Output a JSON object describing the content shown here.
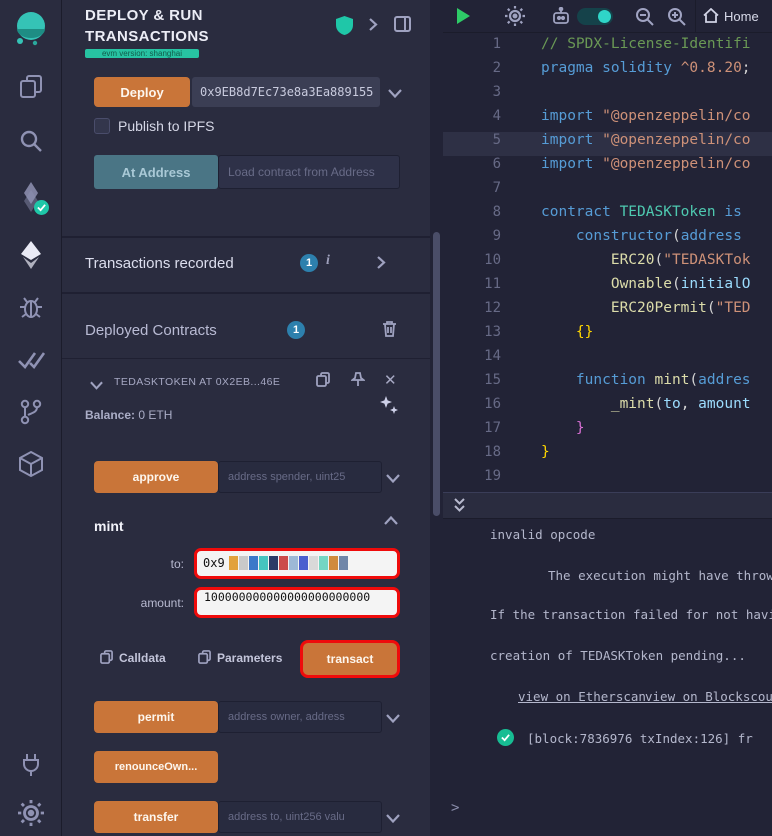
{
  "colors": {
    "accent_orange": "#c97539",
    "accent_teal": "#27c3a2",
    "badge_blue": "#2d80ad",
    "annotation_red": "#ef0b0b",
    "panel_bg": "#2a2c3f",
    "editor_bg": "#222336"
  },
  "header": {
    "title": "DEPLOY & RUN TRANSACTIONS",
    "evm_badge": "evm version: shanghai"
  },
  "deploy": {
    "deploy_button": "Deploy",
    "address_value": "0x9EB8d7Ec73e8a3Ea889155",
    "publish_label": "Publish to IPFS",
    "at_address_button": "At Address",
    "at_address_placeholder": "Load contract from Address"
  },
  "sections": {
    "transactions_recorded": "Transactions recorded",
    "transactions_count": "1",
    "info_glyph": "i",
    "deployed_contracts": "Deployed Contracts",
    "deployed_count": "1"
  },
  "contract": {
    "title": "TEDASKTOKEN AT 0X2EB...46E",
    "balance_label": "Balance:",
    "balance_value": "0 ETH",
    "approve": {
      "label": "approve",
      "placeholder": "address spender, uint25"
    },
    "mint": {
      "label": "mint",
      "to_label": "to:",
      "to_value": "0x9",
      "to_censor_colors": [
        "#e2a13c",
        "#c9c9c9",
        "#3c78c9",
        "#45c4bf",
        "#2b3a67",
        "#cc4b4b",
        "#9db9d6",
        "#4a5fcf",
        "#d9d9d9",
        "#74d6c3",
        "#d08a3c",
        "#7086a8"
      ],
      "amount_label": "amount:",
      "amount_value": "100000000000000000000000",
      "calldata": "Calldata",
      "parameters": "Parameters",
      "transact": "transact"
    },
    "permit": {
      "label": "permit",
      "placeholder": "address owner, address"
    },
    "renounce": {
      "label": "renounceOwn..."
    },
    "transfer": {
      "label": "transfer",
      "placeholder": "address to, uint256 valu"
    }
  },
  "editor": {
    "tab_home": "Home",
    "lines": [
      {
        "n": 1,
        "segs": [
          [
            "cmt",
            "// SPDX-License-Identifi"
          ]
        ]
      },
      {
        "n": 2,
        "segs": [
          [
            "kw",
            "pragma solidity "
          ],
          [
            "str",
            "^0.8.20"
          ],
          [
            "txt",
            ";"
          ]
        ]
      },
      {
        "n": 3,
        "segs": []
      },
      {
        "n": 4,
        "segs": [
          [
            "kw",
            "import "
          ],
          [
            "str",
            "\"@openzeppelin/co"
          ]
        ]
      },
      {
        "n": 5,
        "hl": true,
        "segs": [
          [
            "kw",
            "import "
          ],
          [
            "str",
            "\"@openzeppelin/co"
          ]
        ]
      },
      {
        "n": 6,
        "segs": [
          [
            "kw",
            "import "
          ],
          [
            "str",
            "\"@openzeppelin/co"
          ]
        ]
      },
      {
        "n": 7,
        "segs": []
      },
      {
        "n": 8,
        "segs": [
          [
            "kw",
            "contract "
          ],
          [
            "typ",
            "TEDASKToken "
          ],
          [
            "kw",
            "is"
          ]
        ]
      },
      {
        "n": 9,
        "segs": [
          [
            "txt",
            "    "
          ],
          [
            "kw",
            "constructor"
          ],
          [
            "txt",
            "("
          ],
          [
            "kw",
            "address"
          ]
        ]
      },
      {
        "n": 10,
        "segs": [
          [
            "txt",
            "        "
          ],
          [
            "fn",
            "ERC20"
          ],
          [
            "txt",
            "("
          ],
          [
            "str",
            "\"TEDASKTok"
          ]
        ]
      },
      {
        "n": 11,
        "segs": [
          [
            "txt",
            "        "
          ],
          [
            "fn",
            "Ownable"
          ],
          [
            "txt",
            "("
          ],
          [
            "arg",
            "initialO"
          ]
        ]
      },
      {
        "n": 12,
        "segs": [
          [
            "txt",
            "        "
          ],
          [
            "fn",
            "ERC20Permit"
          ],
          [
            "txt",
            "("
          ],
          [
            "str",
            "\"TED"
          ]
        ]
      },
      {
        "n": 13,
        "segs": [
          [
            "txt",
            "    "
          ],
          [
            "br1",
            "{}"
          ]
        ]
      },
      {
        "n": 14,
        "segs": []
      },
      {
        "n": 15,
        "segs": [
          [
            "txt",
            "    "
          ],
          [
            "kw",
            "function "
          ],
          [
            "fn",
            "mint"
          ],
          [
            "txt",
            "("
          ],
          [
            "kw",
            "addres"
          ]
        ]
      },
      {
        "n": 16,
        "segs": [
          [
            "txt",
            "        "
          ],
          [
            "fn",
            "_mint"
          ],
          [
            "txt",
            "("
          ],
          [
            "arg",
            "to"
          ],
          [
            "txt",
            ", "
          ],
          [
            "arg",
            "amount"
          ]
        ]
      },
      {
        "n": 17,
        "segs": [
          [
            "txt",
            "    "
          ],
          [
            "br2",
            "}"
          ]
        ]
      },
      {
        "n": 18,
        "segs": [
          [
            "br1",
            "}"
          ]
        ]
      },
      {
        "n": 19,
        "segs": []
      }
    ]
  },
  "terminal": {
    "line1": "invalid opcode",
    "line2": "The execution might have throw",
    "line3": "If the transaction failed for not havi",
    "line4": "creation of TEDASKToken pending...",
    "link1": "view on Etherscan",
    "link2": "view on Blockscou",
    "block_info": "[block:7836976 txIndex:126] fr",
    "prompt": ">"
  }
}
